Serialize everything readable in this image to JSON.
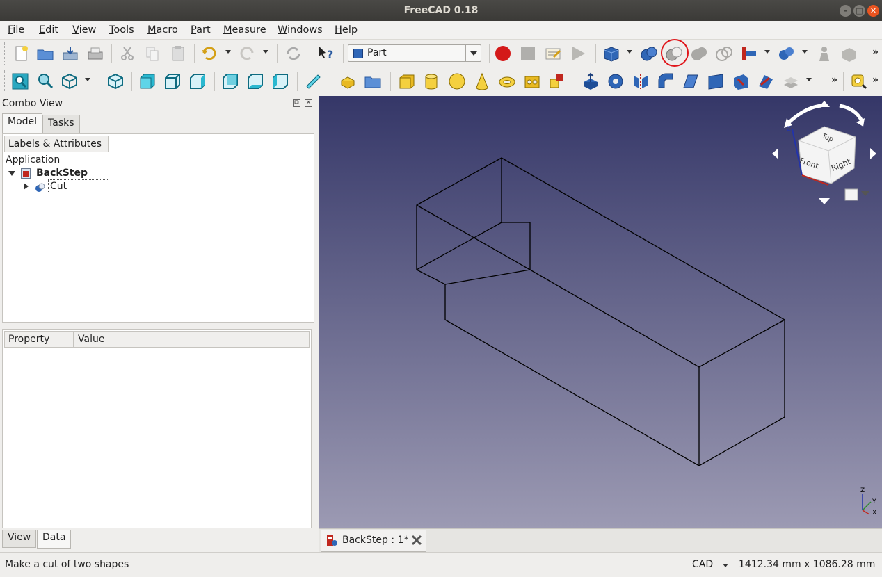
{
  "window": {
    "title": "FreeCAD 0.18"
  },
  "menu": [
    "File",
    "Edit",
    "View",
    "Tools",
    "Macro",
    "Part",
    "Measure",
    "Windows",
    "Help"
  ],
  "toolbar": {
    "workbench": "Part",
    "overflow": "»"
  },
  "combo_view": {
    "title": "Combo View",
    "tabs": [
      "Model",
      "Tasks"
    ],
    "labels_header": "Labels & Attributes",
    "tree": {
      "root": "Application",
      "document": "BackStep",
      "child": "Cut"
    },
    "property_columns": [
      "Property",
      "Value"
    ],
    "bottom_tabs": [
      "View",
      "Data"
    ]
  },
  "navcube": {
    "top": "Top",
    "front": "Front",
    "right": "Right",
    "axis_z": "Z",
    "axis_y": "Y",
    "axis_x": "X"
  },
  "document_tab": {
    "label": "BackStep : 1*"
  },
  "statusbar": {
    "message": "Make a cut of two shapes",
    "navigation_style": "CAD",
    "dimensions": "1412.34 mm x 1086.28 mm"
  },
  "colors": {
    "viewport_top": "#353768",
    "viewport_bottom": "#9c9ab3",
    "highlight": "#e0161b",
    "accent": "#e95420"
  }
}
